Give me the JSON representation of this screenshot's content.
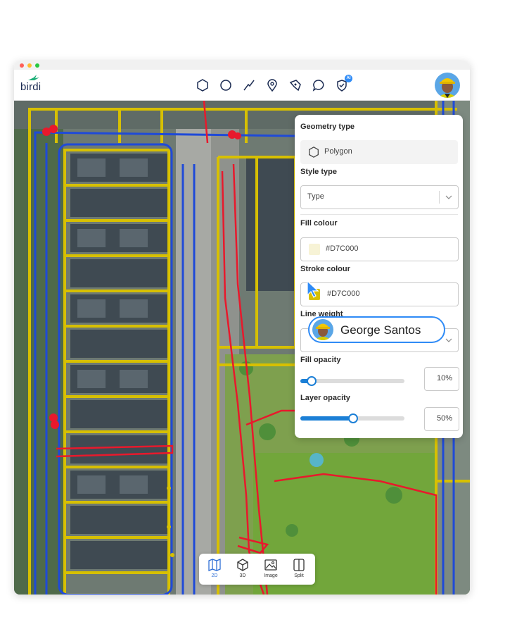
{
  "app": {
    "logo_text": "birdi",
    "brand_color": "#1b2b52"
  },
  "toolbar": {
    "tools": [
      "hexagon-icon",
      "circle-icon",
      "line-icon",
      "pin-icon",
      "pen-icon",
      "comment-icon",
      "ai-shield-icon"
    ],
    "ai_badge": "AI"
  },
  "panel": {
    "geometry_type_label": "Geometry type",
    "geometry_type_value": "Polygon",
    "style_type_label": "Style type",
    "style_type_value": "Type",
    "fill_colour_label": "Fill colour",
    "fill_colour_value": "#D7C000",
    "stroke_colour_label": "Stroke colour",
    "stroke_colour_value": "#D7C000",
    "line_weight_label": "Line weight",
    "fill_opacity_label": "Fill opacity",
    "fill_opacity_value": "10%",
    "fill_opacity_fraction": 0.1,
    "layer_opacity_label": "Layer opacity",
    "layer_opacity_value": "50%",
    "layer_opacity_fraction": 0.5,
    "swatch_fill_color": "#f7f3d6",
    "swatch_stroke_color": "#D7C000",
    "accent": "#1b7fd6"
  },
  "collaborator": {
    "name": "George Santos"
  },
  "view_tabs": [
    {
      "label": "2D",
      "active": true
    },
    {
      "label": "3D",
      "active": false
    },
    {
      "label": "Image",
      "active": false
    },
    {
      "label": "Split",
      "active": false
    }
  ]
}
